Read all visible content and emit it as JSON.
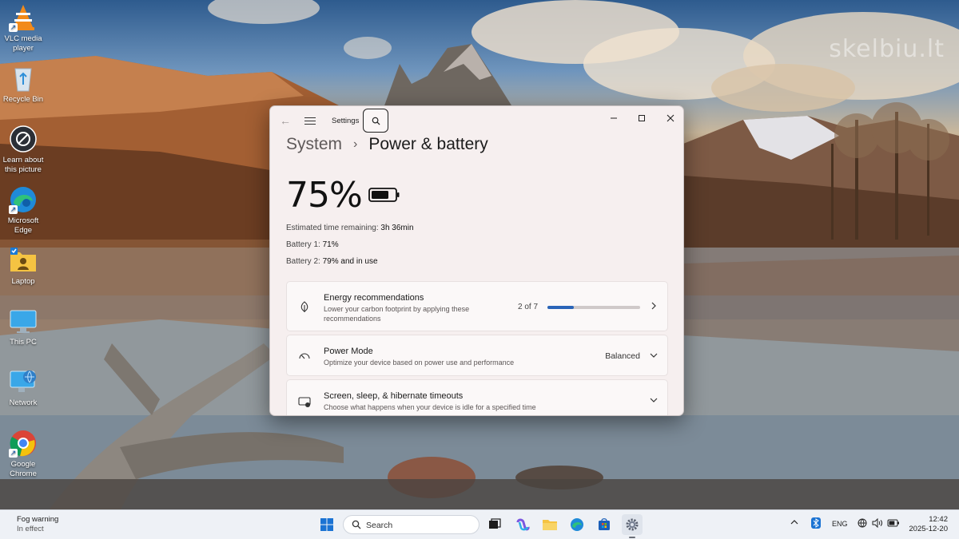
{
  "desktop": {
    "watermark": "skelbiu.lt",
    "icons": [
      {
        "label": "VLC media player"
      },
      {
        "label": "Recycle Bin"
      },
      {
        "label": "Learn about this picture"
      },
      {
        "label": "Microsoft Edge"
      },
      {
        "label": "Laptop"
      },
      {
        "label": "This PC"
      },
      {
        "label": "Network"
      },
      {
        "label": "Google Chrome"
      }
    ]
  },
  "window": {
    "app_title": "Settings",
    "breadcrumb": {
      "parent": "System",
      "current": "Power & battery"
    },
    "battery": {
      "percent": "75%",
      "level": 0.75,
      "estimated_label": "Estimated time remaining:",
      "estimated_value": "3h 36min",
      "battery1_label": "Battery 1:",
      "battery1_value": "71%",
      "battery2_label": "Battery 2:",
      "battery2_value": "79% and in use"
    },
    "cards": {
      "energy": {
        "title": "Energy recommendations",
        "subtitle_line1": "Lower your carbon footprint by applying these",
        "subtitle_line2": "recommendations",
        "progress_text": "2 of 7",
        "progress": 0.2857
      },
      "power_mode": {
        "title": "Power Mode",
        "subtitle": "Optimize your device based on power use and performance",
        "value": "Balanced"
      },
      "screen_sleep": {
        "title": "Screen, sleep, & hibernate timeouts",
        "subtitle": "Choose what happens when your device is idle for a specified time"
      }
    }
  },
  "taskbar": {
    "weather_title": "Fog warning",
    "weather_sub": "In effect",
    "search_placeholder": "Search",
    "language": "ENG",
    "time": "12:42",
    "date": "2025-12-20"
  },
  "colors": {
    "accent": "#2a64b8",
    "window_bg": "#f6efef",
    "taskbar_bg": "#eef1f6"
  }
}
